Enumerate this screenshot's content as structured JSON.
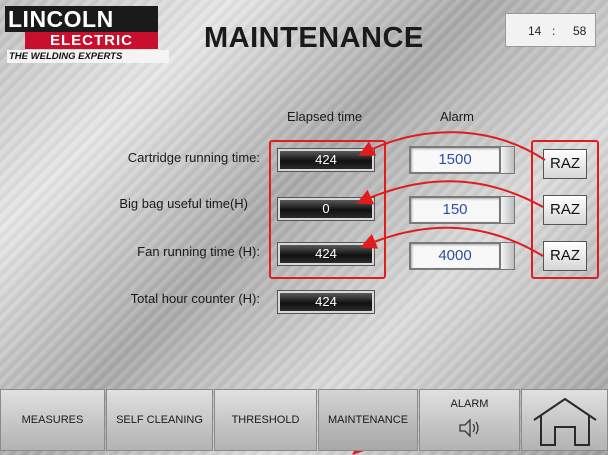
{
  "brand": {
    "line1": "LINCOLN",
    "line2": "ELECTRIC",
    "tagline": "THE WELDING EXPERTS"
  },
  "header": {
    "title": "MAINTENANCE",
    "clock_hour": "14",
    "clock_sep": ":",
    "clock_min": "58"
  },
  "columns": {
    "elapsed": "Elapsed time",
    "alarm": "Alarm"
  },
  "rows": [
    {
      "label": "Cartridge running time:",
      "elapsed": "424",
      "alarm": "1500",
      "reset": "RAZ"
    },
    {
      "label": "Big bag useful time(H)",
      "elapsed": "0",
      "alarm": "150",
      "reset": "RAZ"
    },
    {
      "label": "Fan running time (H):",
      "elapsed": "424",
      "alarm": "4000",
      "reset": "RAZ"
    }
  ],
  "total": {
    "label": "Total hour counter (H):",
    "value": "424"
  },
  "nav": {
    "measures": "MEASURES",
    "self_cleaning": "SELF CLEANING",
    "threshold": "THRESHOLD",
    "maintenance": "MAINTENANCE",
    "alarm": "ALARM",
    "alarm_icon": "speaker-icon",
    "home_icon": "home-icon"
  },
  "colors": {
    "annotation": "#e01c1c",
    "alarm_value": "#2a4fa8",
    "brand_red": "#c8102e"
  }
}
